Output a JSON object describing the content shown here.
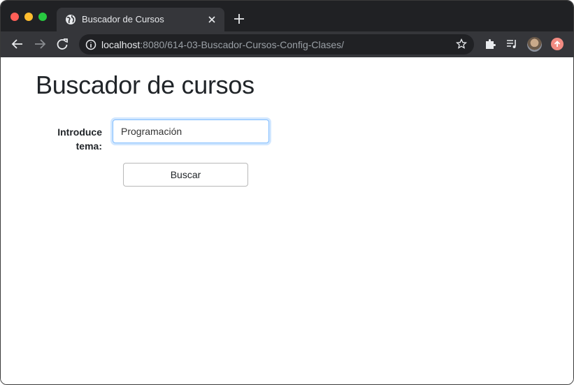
{
  "browser": {
    "tab": {
      "title": "Buscador de Cursos",
      "favicon": "globe-icon"
    },
    "address": {
      "host": "localhost",
      "rest": ":8080/614-03-Buscador-Cursos-Config-Clases/"
    },
    "colors": {
      "frame": "#202124",
      "toolbar": "#35363a"
    }
  },
  "page": {
    "heading": "Buscador de cursos",
    "form": {
      "label": "Introduce tema:",
      "input_value": "Programación",
      "submit_label": "Buscar"
    }
  }
}
